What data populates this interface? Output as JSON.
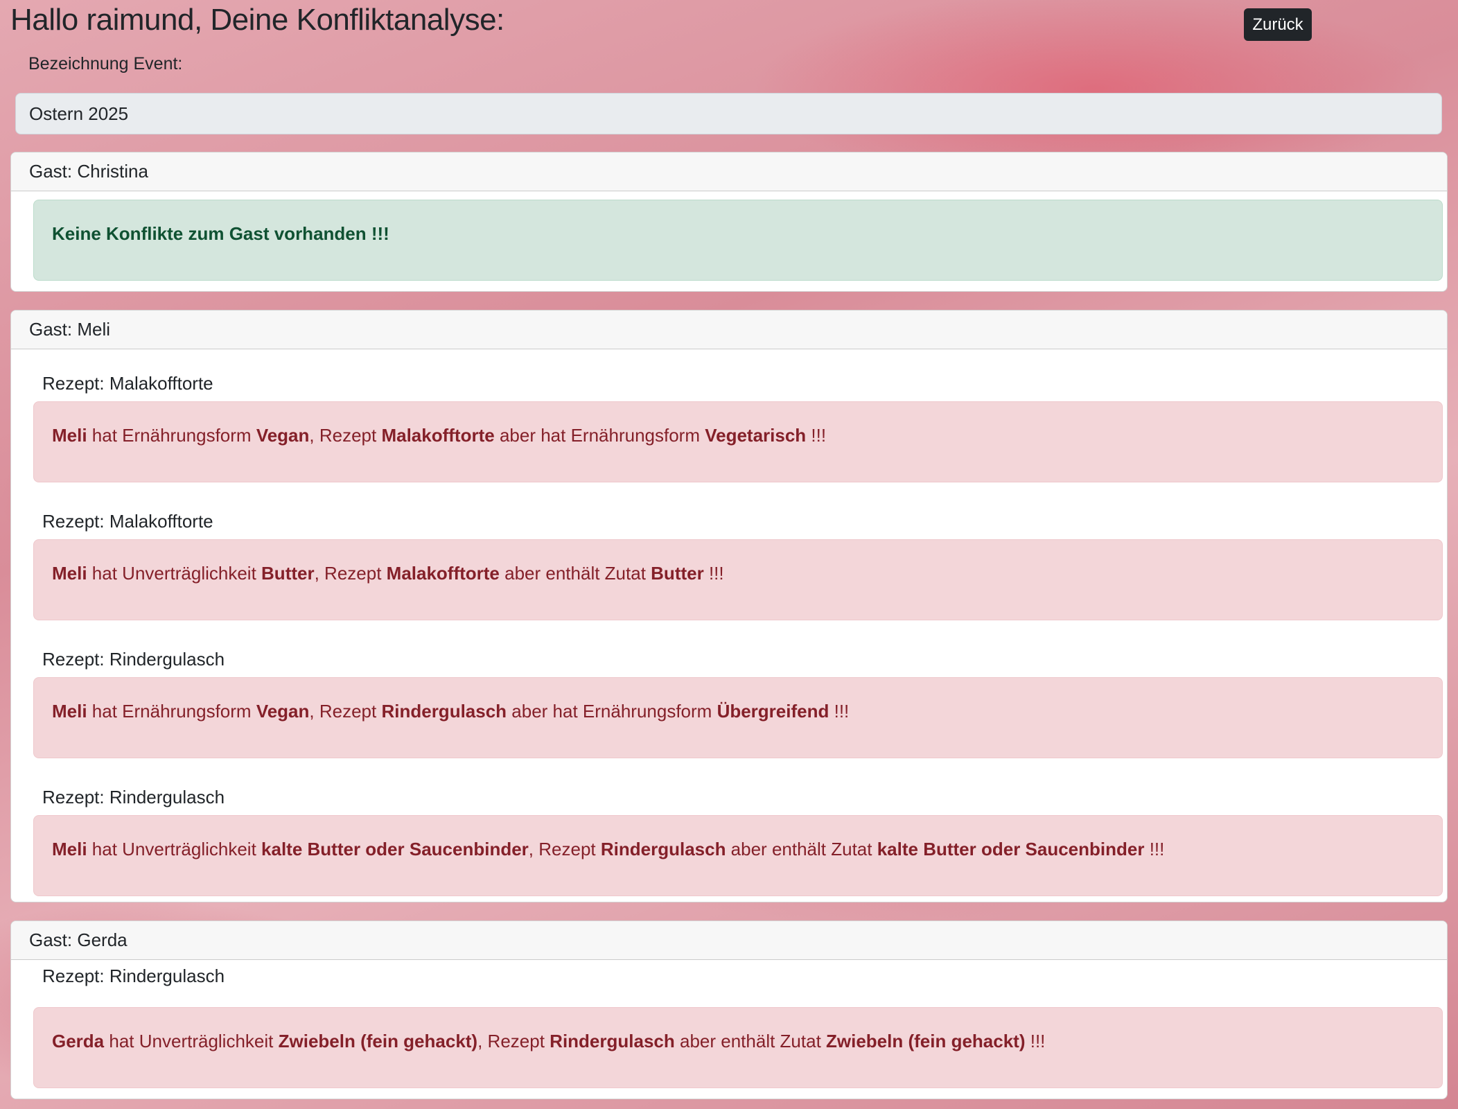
{
  "header": {
    "title": "Hallo raimund, Deine Konfliktanalyse:",
    "back_label": "Zurück"
  },
  "event": {
    "label": "Bezeichnung Event:",
    "value": "Ostern 2025"
  },
  "guests": [
    {
      "header": "Gast: Christina",
      "no_conflict": "Keine Konflikte zum Gast vorhanden !!!"
    },
    {
      "header": "Gast: Meli",
      "conflicts": [
        {
          "recipe_label": "Rezept: Malakofftorte",
          "guest": "Meli",
          "t1": " hat Ernährungsform ",
          "v1": "Vegan",
          "t2": ", Rezept ",
          "recipe": "Malakofftorte",
          "t3": " aber hat Ernährungsform ",
          "v2": "Vegetarisch",
          "t4": " !!!"
        },
        {
          "recipe_label": "Rezept: Malakofftorte",
          "guest": "Meli",
          "t1": " hat Unverträglichkeit ",
          "v1": "Butter",
          "t2": ", Rezept ",
          "recipe": "Malakofftorte",
          "t3": " aber enthält Zutat ",
          "v2": "Butter",
          "t4": " !!!"
        },
        {
          "recipe_label": "Rezept: Rindergulasch",
          "guest": "Meli",
          "t1": " hat Ernährungsform ",
          "v1": "Vegan",
          "t2": ", Rezept ",
          "recipe": "Rindergulasch",
          "t3": " aber hat Ernährungsform ",
          "v2": "Übergreifend",
          "t4": " !!!"
        },
        {
          "recipe_label": "Rezept: Rindergulasch",
          "guest": "Meli",
          "t1": " hat Unverträglichkeit ",
          "v1": "kalte Butter oder Saucenbinder",
          "t2": ", Rezept ",
          "recipe": "Rindergulasch",
          "t3": " aber enthält Zutat ",
          "v2": "kalte Butter oder Saucenbinder",
          "t4": " !!!"
        }
      ]
    },
    {
      "header": "Gast: Gerda",
      "conflicts": [
        {
          "recipe_label": "Rezept: Rindergulasch",
          "guest": "Gerda",
          "t1": " hat Unverträglichkeit ",
          "v1": "Zwiebeln (fein gehackt)",
          "t2": ", Rezept ",
          "recipe": "Rindergulasch",
          "t3": " aber enthält Zutat ",
          "v2": "Zwiebeln (fein gehackt)",
          "t4": " !!!"
        }
      ]
    }
  ]
}
